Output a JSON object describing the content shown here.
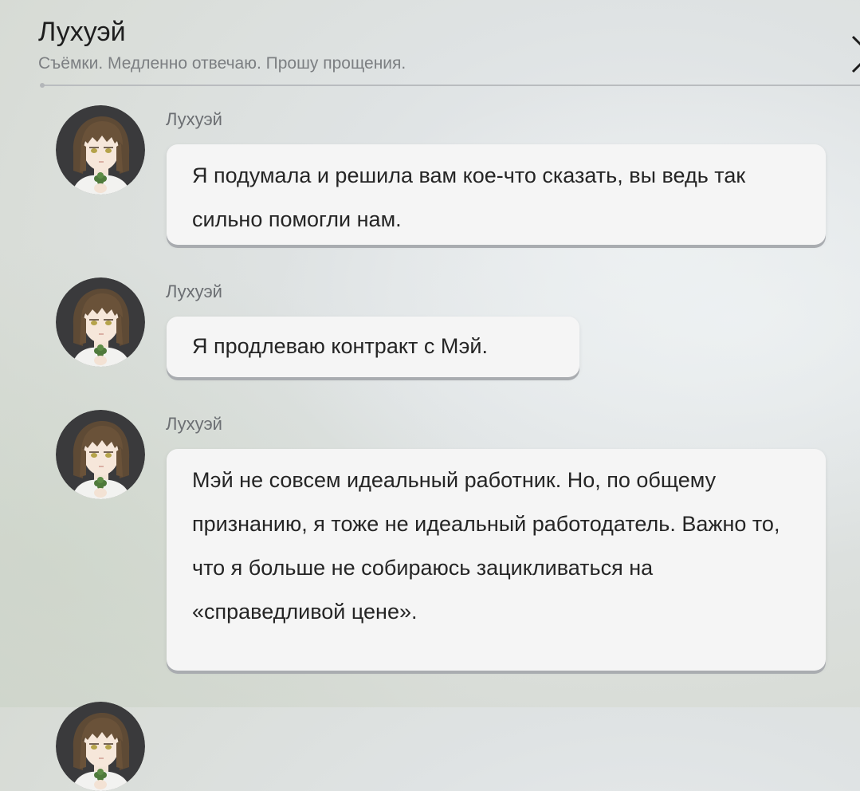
{
  "header": {
    "title": "Лухуэй",
    "status": "Съёмки. Медленно отвечаю. Прошу прощения."
  },
  "messages": [
    {
      "sender": "Лухуэй",
      "avatar": "luhui-avatar",
      "text": "Я подумала и решила вам кое-что сказать, вы ведь так сильно помогли нам."
    },
    {
      "sender": "Лухуэй",
      "avatar": "luhui-avatar",
      "text": "Я продлеваю контракт с Мэй."
    },
    {
      "sender": "Лухуэй",
      "avatar": "luhui-avatar",
      "text": "Мэй не совсем идеальный работник. Но, по общему признанию, я тоже не идеальный работодатель. Важно то, что я больше не собираюсь зацикливаться на «справедливой цене»."
    }
  ],
  "icons": {
    "close": "close-icon"
  },
  "colors": {
    "bubble": "#f5f5f5",
    "bubble_shadow": "#a9acb0",
    "title_text": "#1e1e1e",
    "muted_text": "#7c7f82"
  }
}
